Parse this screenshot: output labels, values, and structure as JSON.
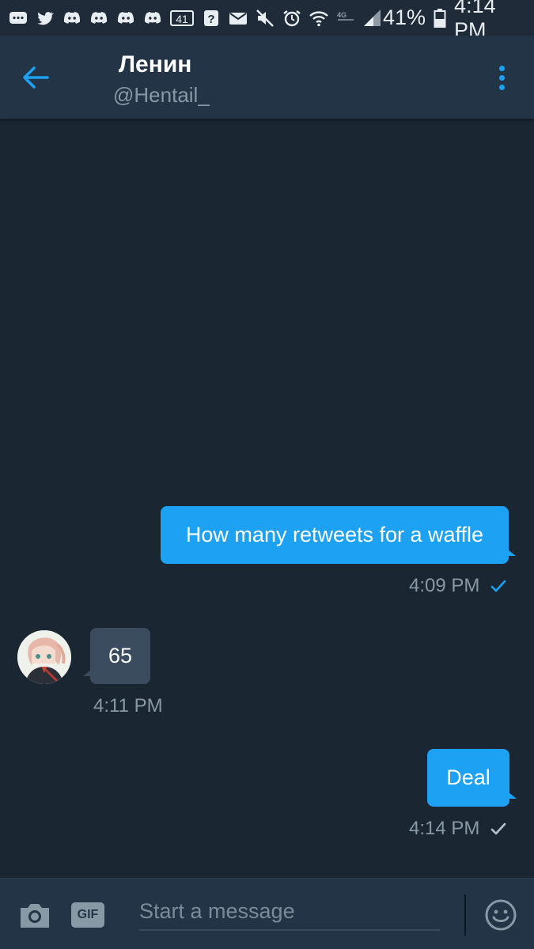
{
  "status_bar": {
    "battery_percent": "41%",
    "time": "4:14 PM",
    "notification_badge": "41"
  },
  "header": {
    "title": "Ленин",
    "handle": "@Hentail_"
  },
  "messages": [
    {
      "direction": "outgoing",
      "text": "How many retweets for a waffle",
      "time": "4:09 PM",
      "status": "read"
    },
    {
      "direction": "incoming",
      "text": "65",
      "time": "4:11 PM"
    },
    {
      "direction": "outgoing",
      "text": "Deal",
      "time": "4:14 PM",
      "status": "sent"
    }
  ],
  "composer": {
    "gif_label": "GIF",
    "placeholder": "Start a message"
  },
  "colors": {
    "accent": "#1da1f2",
    "background": "#1b2633",
    "header": "#243447",
    "incoming_bubble": "#3b4c5e",
    "muted_text": "#8899a6"
  }
}
